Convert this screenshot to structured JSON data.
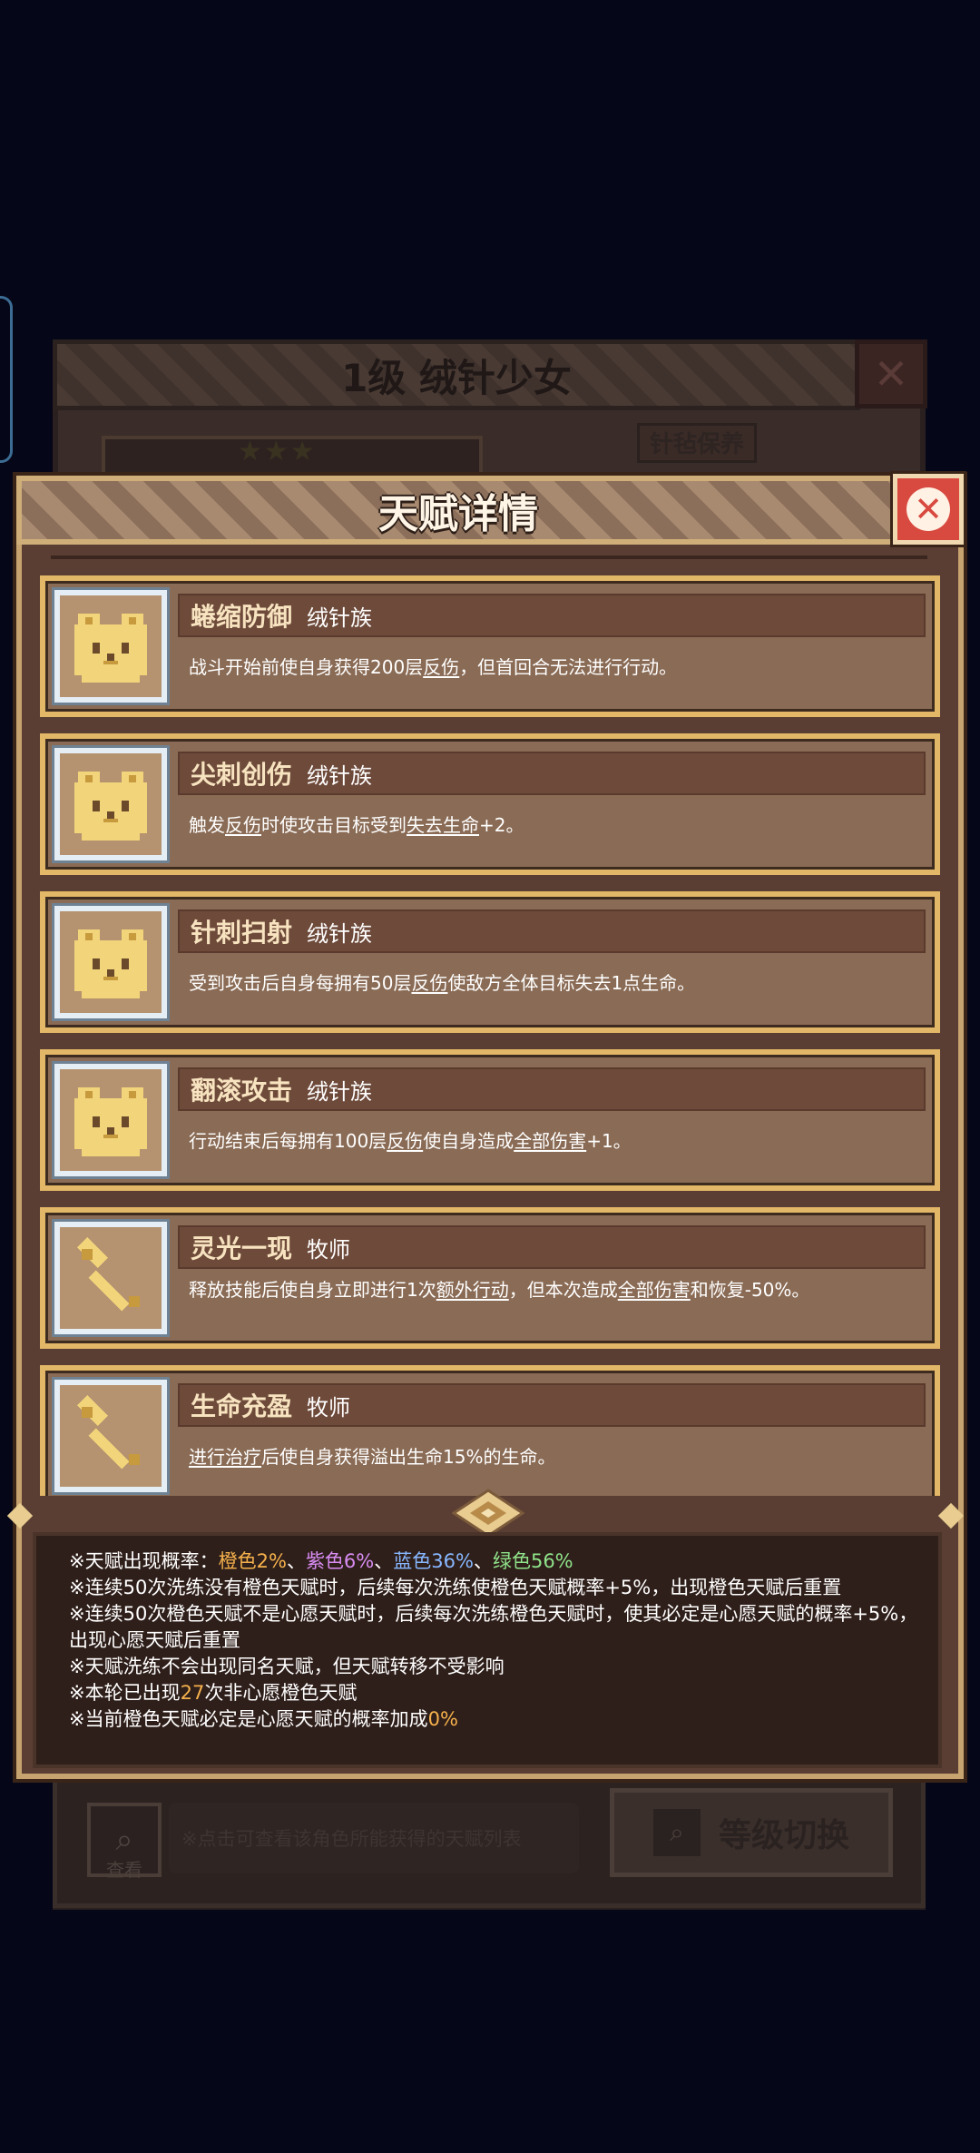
{
  "background": {
    "window_title": "1级 绒针少女",
    "tag_label": "针毡保养",
    "view_button_label": "查看",
    "hint_text": "※点击可查看该角色所能获得的天赋列表",
    "level_switch_label": "等级切换"
  },
  "dialog": {
    "title": "天赋详情",
    "close_icon": "close-icon"
  },
  "talents": [
    {
      "name": "蜷缩防御",
      "tribe": "绒针族",
      "icon": "hamster-icon",
      "desc_parts": [
        "战斗开始前使自身获得200层",
        "反伤",
        "，但首回合无法进行行动。"
      ]
    },
    {
      "name": "尖刺创伤",
      "tribe": "绒针族",
      "icon": "hamster-icon",
      "desc_parts": [
        "触发",
        "反伤",
        "时使攻击目标受到",
        "失去生命",
        "+2。"
      ]
    },
    {
      "name": "针刺扫射",
      "tribe": "绒针族",
      "icon": "hamster-icon",
      "desc_parts": [
        "受到攻击后自身每拥有50层",
        "反伤",
        "使敌方全体目标失去1点生命。"
      ]
    },
    {
      "name": "翻滚攻击",
      "tribe": "绒针族",
      "icon": "hamster-icon",
      "desc_parts": [
        "行动结束后每拥有100层",
        "反伤",
        "使自身造成",
        "全部伤害",
        "+1。"
      ]
    },
    {
      "name": "灵光一现",
      "tribe": "牧师",
      "icon": "hammer-icon",
      "desc_parts": [
        "释放技能后使自身立即进行1次",
        "额外行动",
        "，但本次造成",
        "全部伤害",
        "和恢复-50%。"
      ]
    },
    {
      "name": "生命充盈",
      "tribe": "牧师",
      "icon": "hammer-icon",
      "desc_parts": [
        "进行治疗",
        "后使自身获得溢出生命15%的生命。"
      ]
    }
  ],
  "info": {
    "line1_prefix": "※天赋出现概率：",
    "rate_orange": "橙色2%",
    "sep1": "、",
    "rate_purple": "紫色6%",
    "sep2": "、",
    "rate_blue": "蓝色36%",
    "sep3": "、",
    "rate_green": "绿色56%",
    "line2": "※连续50次洗练没有橙色天赋时，后续每次洗练使橙色天赋概率+5%，出现橙色天赋后重置",
    "line3": "※连续50次橙色天赋不是心愿天赋时，后续每次洗练橙色天赋时，使其必定是心愿天赋的概率+5%，出现心愿天赋后重置",
    "line4": "※天赋洗练不会出现同名天赋，但天赋转移不受影响",
    "line5_prefix": "※本轮已出现",
    "line5_count": "27",
    "line5_suffix": "次非心愿橙色天赋",
    "line6_prefix": "※当前橙色天赋必定是心愿天赋的概率加成",
    "line6_value": "0%"
  },
  "colors": {
    "orange": "#f5b14c",
    "purple": "#d88cf2",
    "blue": "#87b7ff",
    "green": "#8fe38a",
    "card_border": "#e2b767"
  }
}
